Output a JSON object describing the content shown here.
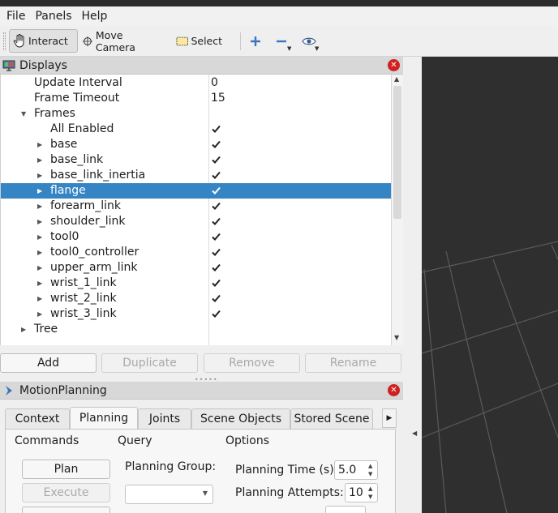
{
  "menu": {
    "file": "File",
    "panels": "Panels",
    "help": "Help"
  },
  "toolbar": {
    "interact": "Interact",
    "move_camera": "Move Camera",
    "select": "Select"
  },
  "displays": {
    "title": "Displays",
    "rows": [
      {
        "label": "Update Interval",
        "value": "0"
      },
      {
        "label": "Frame Timeout",
        "value": "15"
      },
      {
        "label": "Frames"
      },
      {
        "label": "All Enabled"
      },
      {
        "label": "base"
      },
      {
        "label": "base_link"
      },
      {
        "label": "base_link_inertia"
      },
      {
        "label": "flange"
      },
      {
        "label": "forearm_link"
      },
      {
        "label": "shoulder_link"
      },
      {
        "label": "tool0"
      },
      {
        "label": "tool0_controller"
      },
      {
        "label": "upper_arm_link"
      },
      {
        "label": "wrist_1_link"
      },
      {
        "label": "wrist_2_link"
      },
      {
        "label": "wrist_3_link"
      },
      {
        "label": "Tree"
      }
    ],
    "buttons": {
      "add": "Add",
      "duplicate": "Duplicate",
      "remove": "Remove",
      "rename": "Rename"
    }
  },
  "motion_planning": {
    "title": "MotionPlanning",
    "tabs": [
      "Context",
      "Planning",
      "Joints",
      "Scene Objects",
      "Stored Scene"
    ],
    "commands": {
      "title": "Commands",
      "plan": "Plan",
      "execute": "Execute"
    },
    "query": {
      "title": "Query",
      "planning_group": "Planning Group:",
      "planning_group_value": ""
    },
    "options": {
      "title": "Options",
      "planning_time_label": "Planning Time (s):",
      "planning_time_value": "5.0",
      "planning_attempts_label": "Planning Attempts:",
      "planning_attempts_value": "10"
    }
  },
  "colors": {
    "selection": "#3584c4",
    "close": "#d02121",
    "viewport": "#2f2f2f",
    "grid": "#5a5a5a"
  },
  "icons": [
    "hand-icon",
    "camera-icon",
    "select-box-icon",
    "plus-icon",
    "minus-icon",
    "eye-icon",
    "monitor-icon",
    "close-icon",
    "motion-planning-icon",
    "checkbox-checked-icon",
    "chevron-right-icon",
    "chevron-down-icon"
  ]
}
